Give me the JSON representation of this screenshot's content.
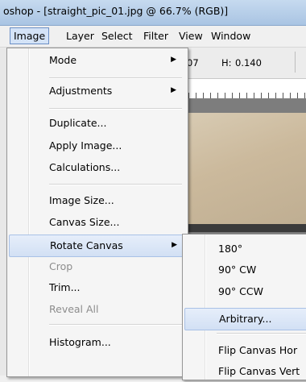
{
  "window": {
    "title": "oshop - [straight_pic_01.jpg @ 66.7% (RGB)]"
  },
  "menubar": {
    "items": [
      "Image",
      "Layer",
      "Select",
      "Filter",
      "View",
      "Window"
    ]
  },
  "options_bar": {
    "width_partial": "07",
    "height_label": "H:",
    "height_value": "0.140"
  },
  "image_menu": {
    "items": [
      {
        "label": "Mode",
        "submenu": true,
        "enabled": true
      },
      {
        "label": "Adjustments",
        "submenu": true,
        "enabled": true
      },
      {
        "label": "Duplicate...",
        "submenu": false,
        "enabled": true
      },
      {
        "label": "Apply Image...",
        "submenu": false,
        "enabled": true
      },
      {
        "label": "Calculations...",
        "submenu": false,
        "enabled": true
      },
      {
        "label": "Image Size...",
        "submenu": false,
        "enabled": true
      },
      {
        "label": "Canvas Size...",
        "submenu": false,
        "enabled": true
      },
      {
        "label": "Rotate Canvas",
        "submenu": true,
        "enabled": true,
        "highlighted": true
      },
      {
        "label": "Crop",
        "submenu": false,
        "enabled": false
      },
      {
        "label": "Trim...",
        "submenu": false,
        "enabled": true
      },
      {
        "label": "Reveal All",
        "submenu": false,
        "enabled": false
      },
      {
        "label": "Histogram...",
        "submenu": false,
        "enabled": true
      }
    ]
  },
  "rotate_submenu": {
    "items": [
      {
        "label": "180°"
      },
      {
        "label": "90° CW"
      },
      {
        "label": "90° CCW"
      },
      {
        "label": "Arbitrary...",
        "highlighted": true
      },
      {
        "label": "Flip Canvas Hor"
      },
      {
        "label": "Flip Canvas Vert"
      }
    ]
  },
  "icons": {
    "submenu_arrow": "chevron-right-icon"
  }
}
